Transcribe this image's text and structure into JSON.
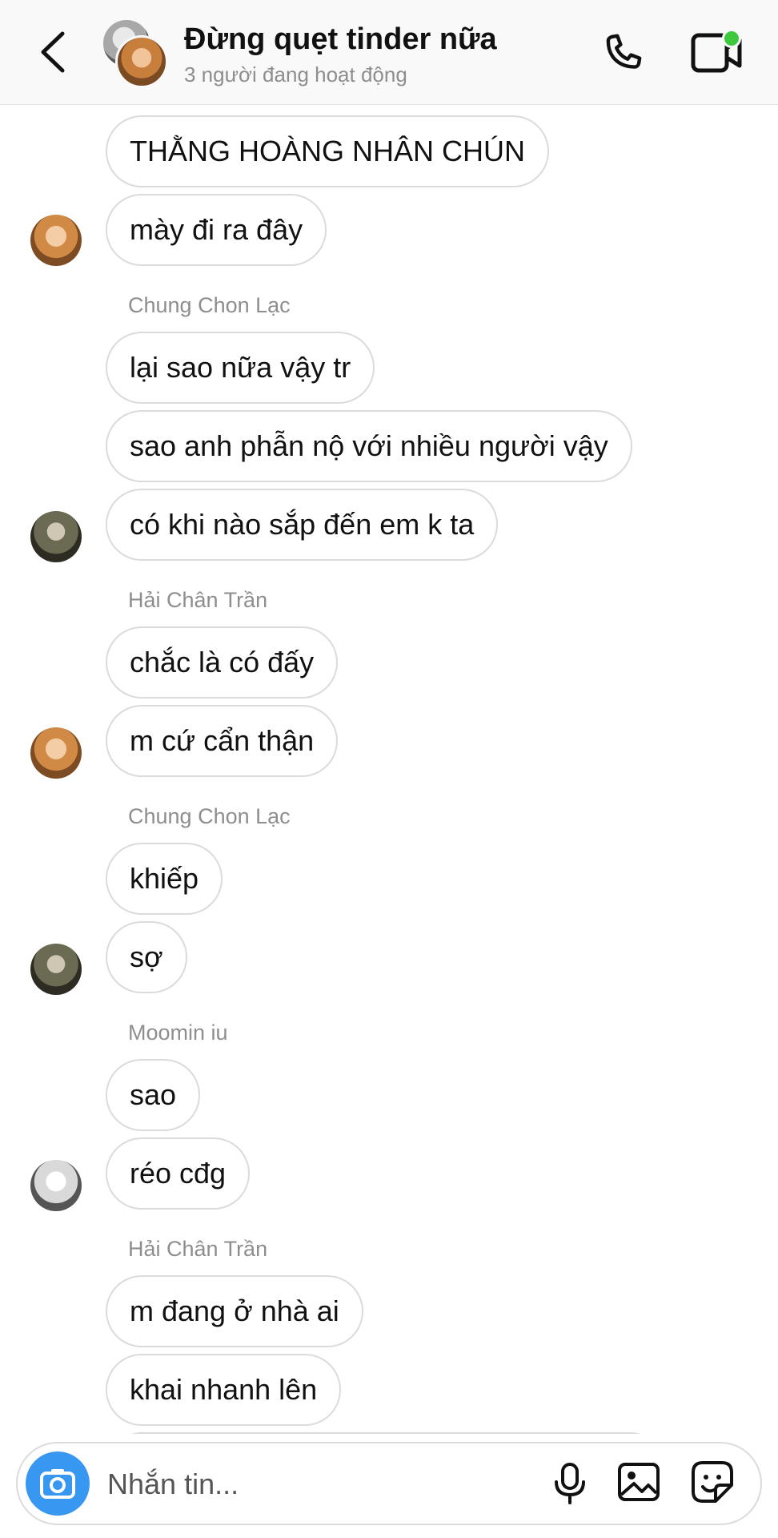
{
  "header": {
    "title": "Đừng quẹt tinder nữa",
    "status": "3 người đang hoạt động",
    "back_icon": "chevron-left-icon",
    "call_icon": "phone-icon",
    "video_icon": "video-icon"
  },
  "thread": {
    "messages": [
      "THẰNG HOÀNG NHÂN CHÚN",
      "mày đi ra đây",
      "lại sao nữa vậy tr",
      "sao anh phẫn nộ với nhiều người vậy",
      "có khi nào sắp đến em k ta",
      "chắc là có đấy",
      "m cứ cẩn thận",
      "khiếp",
      "sợ",
      "sao",
      "réo cđg",
      "m đang ở nhà ai",
      "khai nhanh lên"
    ],
    "senders": [
      "Chung Chon Lạc",
      "Hải Chân Trần",
      "Chung Chon Lạc",
      "Moomin iu",
      "Hải Chân Trần"
    ]
  },
  "composer": {
    "placeholder": "Nhắn tin...",
    "camera_icon": "camera-icon",
    "mic_icon": "microphone-icon",
    "gallery_icon": "image-icon",
    "sticker_icon": "sticker-icon"
  },
  "colors": {
    "accent": "#3897f0",
    "online": "#3ec83e",
    "bubble_border": "#dbdbdb",
    "secondary_text": "#8e8e8e"
  }
}
